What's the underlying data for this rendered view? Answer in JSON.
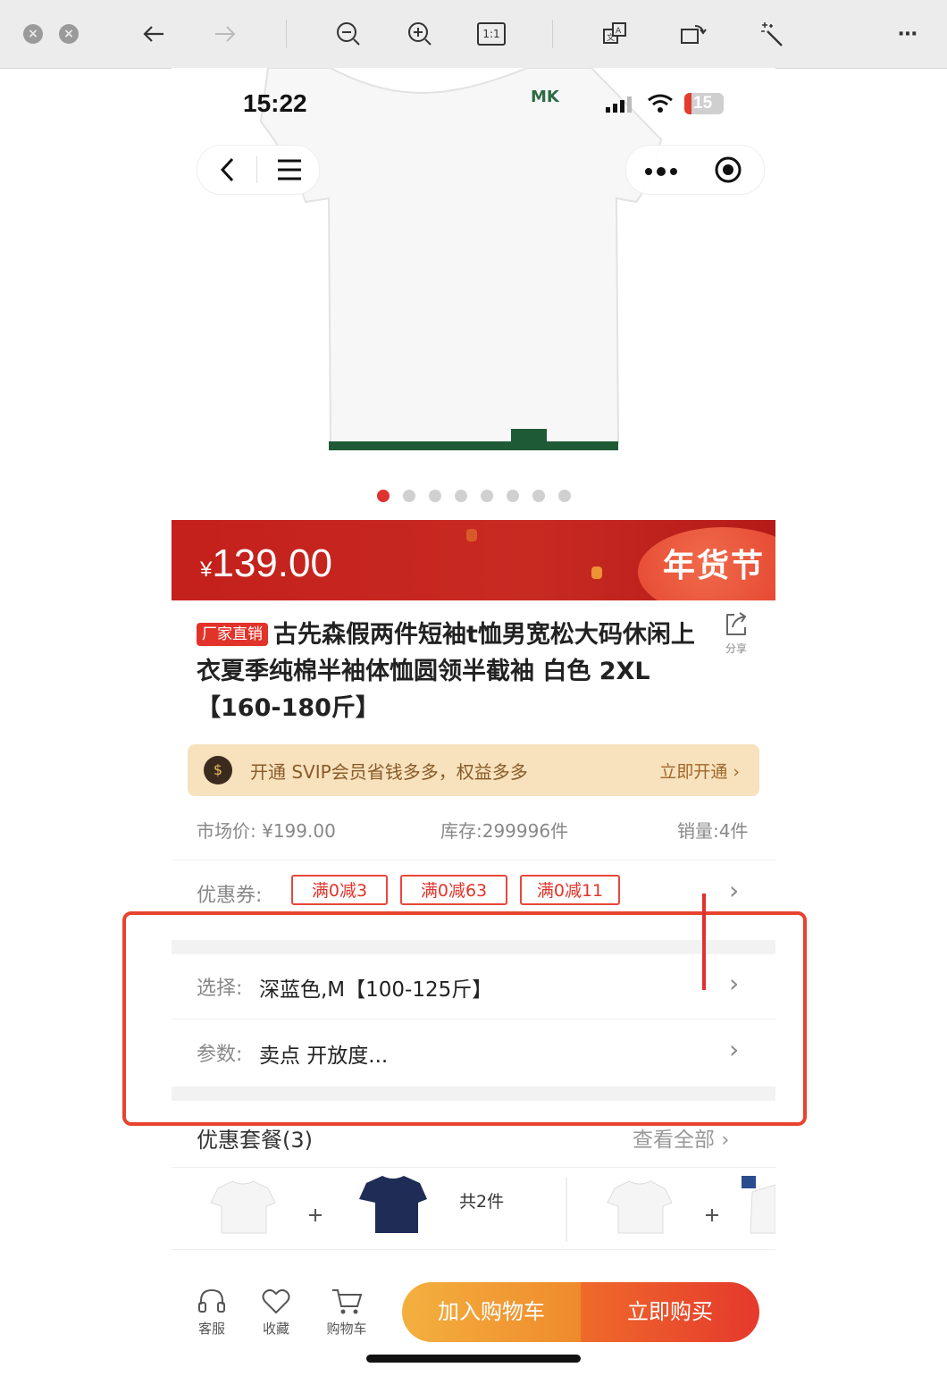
{
  "viewer_toolbar": {
    "icons": [
      "close-icon",
      "close-icon",
      "back-arrow-icon",
      "forward-arrow-icon",
      "zoom-out-icon",
      "zoom-in-icon",
      "actual-size-icon",
      "translate-icon",
      "rotate-icon",
      "magic-wand-icon",
      "more-icon"
    ],
    "actual_size_label": "1:1"
  },
  "status_bar": {
    "time": "15:22",
    "battery": "15",
    "brand_logo": "MK"
  },
  "product": {
    "price_currency": "¥",
    "price": "139.00",
    "festival_badge": "年货节",
    "tag": "厂家直销",
    "title": "古先森假两件短袖t恤男宽松大码休闲上衣夏季纯棉半袖体恤圆领半截袖 白色 2XL【160-180斤】",
    "share_label": "分享",
    "image_count": 8,
    "active_image_index": 0
  },
  "svip": {
    "icon": "diamond-icon",
    "text": "开通 SVIP会员省钱多多，权益多多",
    "link": "立即开通 ›"
  },
  "meta": {
    "market_price": "市场价: ¥199.00",
    "stock": "库存:299996件",
    "sales": "销量:4件"
  },
  "coupons": {
    "label": "优惠券:",
    "items": [
      "满0减3",
      "满0减63",
      "满0减11"
    ]
  },
  "select_row": {
    "label": "选择:",
    "value": "深蓝色,M【100-125斤】"
  },
  "params_row": {
    "label": "参数:",
    "value": "卖点   开放度..."
  },
  "packages": {
    "title": "优惠套餐(3)",
    "link": "查看全部 ›",
    "total": "共2件"
  },
  "bottom_bar": {
    "service": "客服",
    "favorite": "收藏",
    "cart": "购物车",
    "add_to_cart": "加入购物车",
    "buy_now": "立即购买"
  },
  "colors": {
    "price_red": "#c4201c",
    "accent_red": "#e2332a",
    "svip_bg": "#f7e2bd",
    "cart_orange": "#f3b03e"
  }
}
